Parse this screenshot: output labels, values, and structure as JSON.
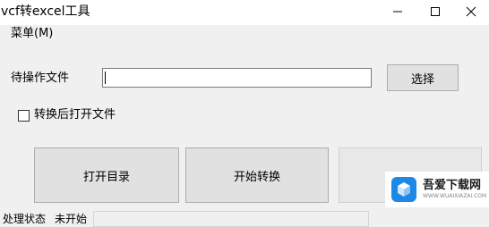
{
  "window": {
    "title": "vcf转excel工具",
    "minimize_icon": "minimize-icon",
    "maximize_icon": "maximize-icon",
    "close_icon": "close-icon"
  },
  "menu": {
    "items": [
      {
        "label": "菜单(M)"
      }
    ]
  },
  "form": {
    "file_label": "待操作文件",
    "file_value": "",
    "select_button": "选择",
    "open_after_label": "转换后打开文件",
    "open_after_checked": false
  },
  "actions": {
    "open_dir": "打开目录",
    "start_convert": "开始转换",
    "third_button": ""
  },
  "watermark": {
    "title": "吾爱下载网",
    "subtitle": "WWW.WUAIXIAZAI.COM",
    "logo_icon": "cube-logo-icon"
  },
  "status": {
    "label": "处理状态",
    "value": "未开始"
  }
}
